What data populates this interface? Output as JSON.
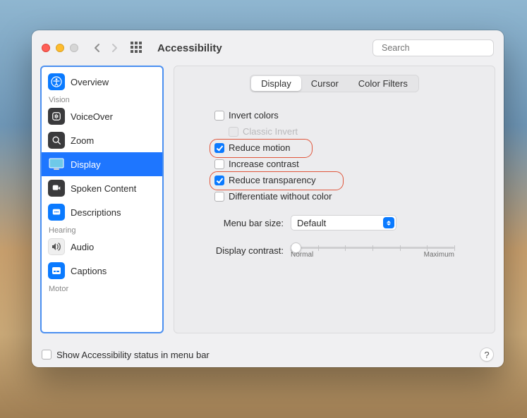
{
  "title": "Accessibility",
  "search": {
    "placeholder": "Search"
  },
  "sidebar": {
    "items": [
      {
        "label": "Overview"
      },
      {
        "label": "VoiceOver"
      },
      {
        "label": "Zoom"
      },
      {
        "label": "Display"
      },
      {
        "label": "Spoken Content"
      },
      {
        "label": "Descriptions"
      },
      {
        "label": "Audio"
      },
      {
        "label": "Captions"
      }
    ],
    "categories": {
      "vision": "Vision",
      "hearing": "Hearing",
      "motor": "Motor"
    }
  },
  "tabs": {
    "display": "Display",
    "cursor": "Cursor",
    "color_filters": "Color Filters"
  },
  "options": {
    "invert_colors": "Invert colors",
    "classic_invert": "Classic Invert",
    "reduce_motion": "Reduce motion",
    "increase_contrast": "Increase contrast",
    "reduce_transparency": "Reduce transparency",
    "differentiate_without_color": "Differentiate without color"
  },
  "menu_bar_size": {
    "label": "Menu bar size:",
    "value": "Default"
  },
  "display_contrast": {
    "label": "Display contrast:",
    "min_label": "Normal",
    "max_label": "Maximum"
  },
  "footer": {
    "show_status": "Show Accessibility status in menu bar"
  },
  "help": "?"
}
